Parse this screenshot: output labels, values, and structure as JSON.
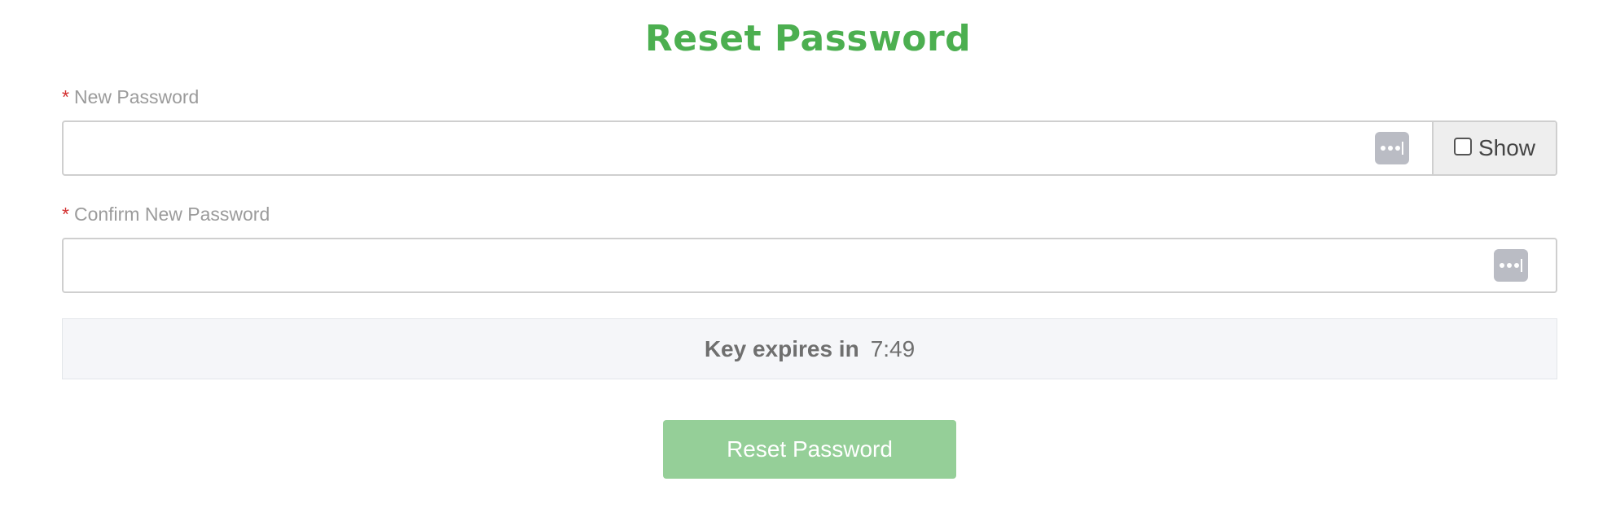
{
  "page": {
    "title": "Reset Password"
  },
  "form": {
    "new_password": {
      "required_marker": "*",
      "label": "New Password",
      "value": "",
      "placeholder": "",
      "password_manager_icon": "password-manager-icon",
      "show_toggle": {
        "label": "Show",
        "checked": false
      }
    },
    "confirm_password": {
      "required_marker": "*",
      "label": "Confirm New Password",
      "value": "",
      "placeholder": "",
      "password_manager_icon": "password-manager-icon"
    },
    "expiry": {
      "label": "Key expires in",
      "time": "7:49"
    },
    "submit_label": "Reset Password"
  },
  "colors": {
    "title": "#4caf50",
    "required": "#d32f2f",
    "button": "#95cf98",
    "expiry_bg": "#f5f6f9"
  }
}
